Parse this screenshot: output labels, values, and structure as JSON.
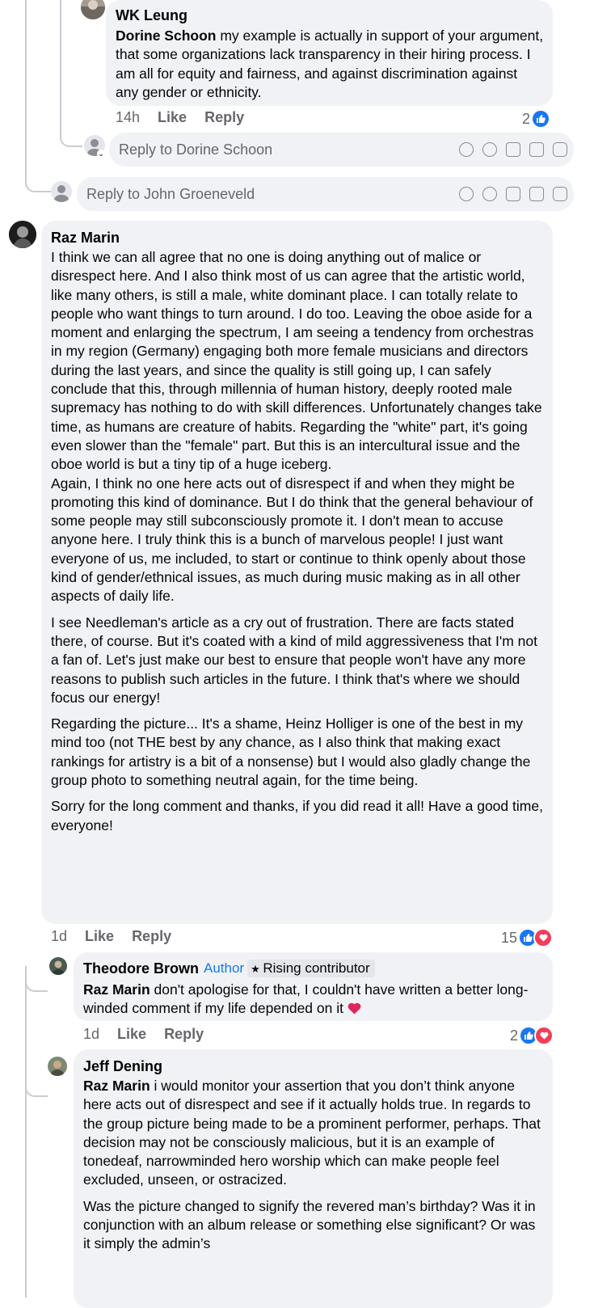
{
  "comments": {
    "wk": {
      "name": "WK Leung",
      "mention": "Dorine Schoon",
      "text": " my example is actually in support of your argument, that some organizations lack transparency in their hiring process. I am all for equity and fairness, and against discrimination against any gender or ethnicity.",
      "time": "14h",
      "like": "Like",
      "reply": "Reply",
      "reactions": "2"
    },
    "reply_dorine": {
      "placeholder": "Reply to Dorine Schoon"
    },
    "reply_john": {
      "placeholder": "Reply to John Groeneveld"
    },
    "raz": {
      "name": "Raz Marin",
      "p1": "I think we can all agree that no one is doing anything out of malice or disrespect here. And I also think most of us can agree that the artistic world, like many others, is still a male, white dominant place. I can totally relate to people who want things to turn around. I do too. Leaving the oboe aside for a moment and enlarging the spectrum, I am seeing a tendency from orchestras in my region (Germany) engaging both more female musicians and directors during the last years, and since the quality is still going up, I can safely conclude that this, through millennia of human history, deeply rooted male supremacy has nothing to do with skill differences. Unfortunately changes take time, as humans are creature of habits. Regarding the \"white\" part, it's going even slower than the \"female\" part. But this is an intercultural issue and the oboe world is but a tiny tip of a huge iceberg.",
      "p2": "Again, I think no one here acts out of disrespect if and when they might be promoting this kind of dominance. But I do think that the general behaviour of some people may still subconsciously promote it. I don't mean to accuse anyone here. I truly think this is a bunch of marvelous people! I just want everyone of us, me included, to start or continue to think openly about those kind of gender/ethnical issues, as much during music making as in all other aspects of daily life.",
      "p3": "I see Needleman's article as a cry out of frustration. There are facts stated there, of course. But it's coated with a kind of mild aggressiveness that I'm not a fan of. Let's just make our best to ensure that people won't have any more reasons to publish such articles in the future. I think that's where we should focus our energy!",
      "p4": "Regarding the picture... It's a shame, Heinz Holliger is one of the best in my mind too (not THE best by any chance, as I also think that making exact rankings for artistry is a bit of a nonsense) but I would also gladly change the group photo to something neutral again, for the time being.",
      "p5": "Sorry for the long comment and thanks, if you did read it all! Have a good time, everyone!",
      "time": "1d",
      "like": "Like",
      "reply": "Reply",
      "reactions": "15"
    },
    "theodore": {
      "name": "Theodore Brown",
      "author": "Author",
      "badge": "Rising contributor",
      "mention": "Raz Marin",
      "text": " don't apologise for that, I couldn't have written a better long-winded comment if my life depended on it",
      "time": "1d",
      "like": "Like",
      "reply": "Reply",
      "reactions": "2"
    },
    "jeff": {
      "name": "Jeff Dening",
      "mention": "Raz Marin",
      "p1": " i would monitor your assertion that you don’t think anyone here acts out of disrespect and see if it actually holds true. In regards to the group picture being made to be a prominent performer, perhaps. That decision may not be consciously malicious, but it is an example of tonedeaf, narrowminded hero worship which can make people feel excluded, unseen, or ostracized.",
      "p2": "Was the picture changed to signify the revered man’s birthday? Was it in conjunction with an album release or something else significant? Or was it simply the admin’s"
    }
  },
  "colors": {
    "like": "#1877f2",
    "love": "#f33e58",
    "bubble": "#f0f2f5",
    "meta": "#65676b"
  }
}
